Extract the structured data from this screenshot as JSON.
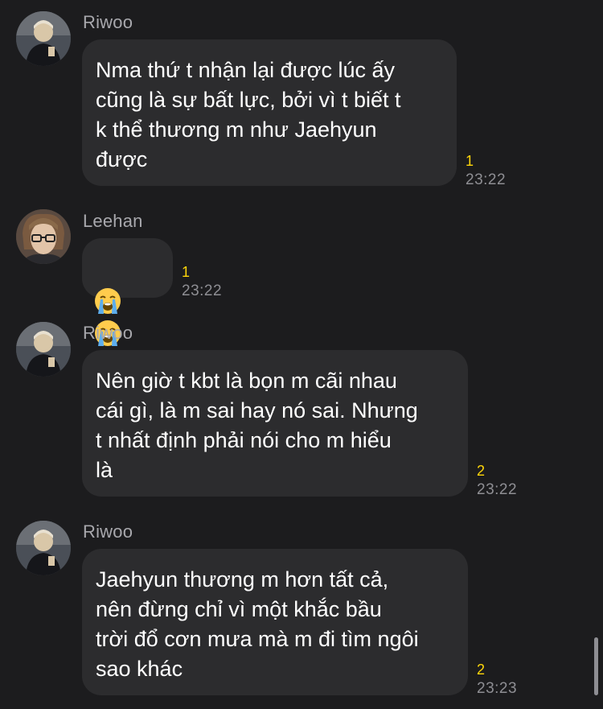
{
  "messages": [
    {
      "sender": "Riwoo",
      "text": "Nma thứ t nhận lại được lúc ấy\ncũng là sự bất lực, bởi vì t biết t\nk thể thương m như Jaehyun\nđược",
      "unread": "1",
      "time": "23:22"
    },
    {
      "sender": "Leehan",
      "emoji": [
        "loudly-crying-face",
        "loudly-crying-face"
      ],
      "unread": "1",
      "time": "23:22"
    },
    {
      "sender": "Riwoo",
      "text": "Nên giờ t kbt là bọn m cãi nhau\ncái gì, là m sai hay nó sai. Nhưng\nt nhất định phải nói cho m hiểu\nlà",
      "unread": "2",
      "time": "23:22"
    },
    {
      "sender": "Riwoo",
      "text": "Jaehyun thương m hơn tất cả,\nnên đừng chỉ vì một khắc bầu\ntrời đổ cơn mưa mà m đi tìm ngôi\nsao khác",
      "unread": "2",
      "time": "23:23"
    }
  ],
  "colors": {
    "background": "#1c1c1e",
    "bubble": "#2c2c2e",
    "unread_count": "#ffd60a",
    "timestamp": "#8e8e93",
    "sender_name": "#a8a8ad"
  }
}
